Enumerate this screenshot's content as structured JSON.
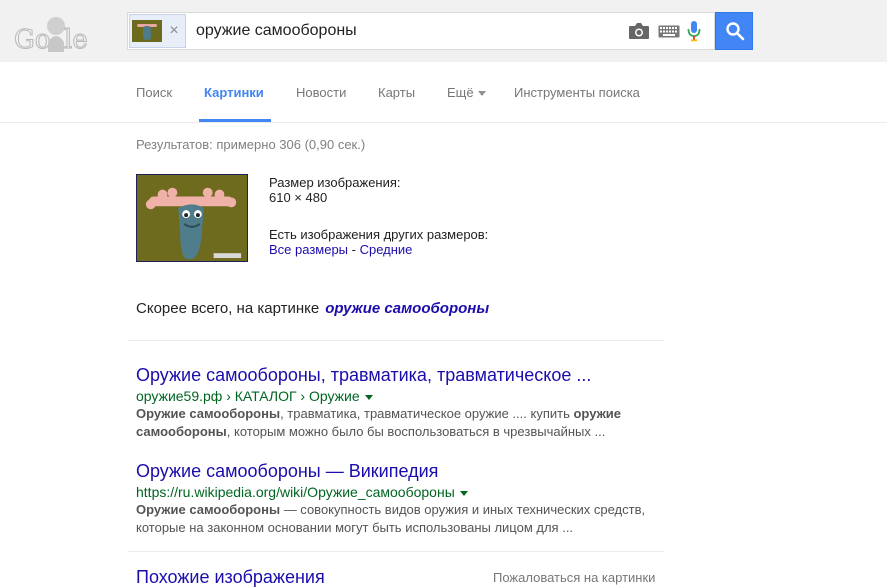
{
  "header": {
    "logo_text": "Google",
    "search": {
      "query": "оружие самообороны",
      "chip_close": "×"
    },
    "icons": [
      "camera-icon",
      "keyboard-icon",
      "mic-icon",
      "search-icon"
    ]
  },
  "tabs": [
    {
      "label": "Поиск",
      "active": false
    },
    {
      "label": "Картинки",
      "active": true
    },
    {
      "label": "Новости",
      "active": false
    },
    {
      "label": "Карты",
      "active": false
    },
    {
      "label": "Ещё",
      "active": false
    },
    {
      "label": "Инструменты поиска",
      "active": false
    }
  ],
  "results_count": "Результатов: примерно 306 (0,90 сек.)",
  "image_info": {
    "size_label": "Размер изображения:",
    "size_value": "610 × 480",
    "other_sizes_label": "Есть изображения других размеров:",
    "all_sizes": "Все размеры",
    "separator": " - ",
    "medium": "Средние"
  },
  "best_guess": {
    "label": "Скорее всего, на картинке",
    "query": "оружие самообороны"
  },
  "results": [
    {
      "title": "Оружие самообороны, травматика, травматическое ...",
      "url": "оружие59.рф › КАТАЛОГ › Оружие",
      "snippet_b1": "Оружие самообороны",
      "snippet_t1": ", травматика, травматическое оружие .... купить ",
      "snippet_b2": "оружие самообороны",
      "snippet_t2": ", которым можно было бы воспользоваться в чрезвычайных ..."
    },
    {
      "title": "Оружие самообороны — Википедия",
      "url": "https://ru.wikipedia.org/wiki/Оружие_самообороны",
      "snippet_b1": "Оружие самообороны",
      "snippet_t1": " — совокупность видов оружия и иных технических средств, которые на законном основании могут быть использованы лицом для ...",
      "snippet_b2": "",
      "snippet_t2": ""
    }
  ],
  "similar_images": "Похожие изображения",
  "report": "Пожаловаться на картинки",
  "colors": {
    "link": "#1a0dab",
    "url": "#006621",
    "accent": "#4285f4"
  }
}
